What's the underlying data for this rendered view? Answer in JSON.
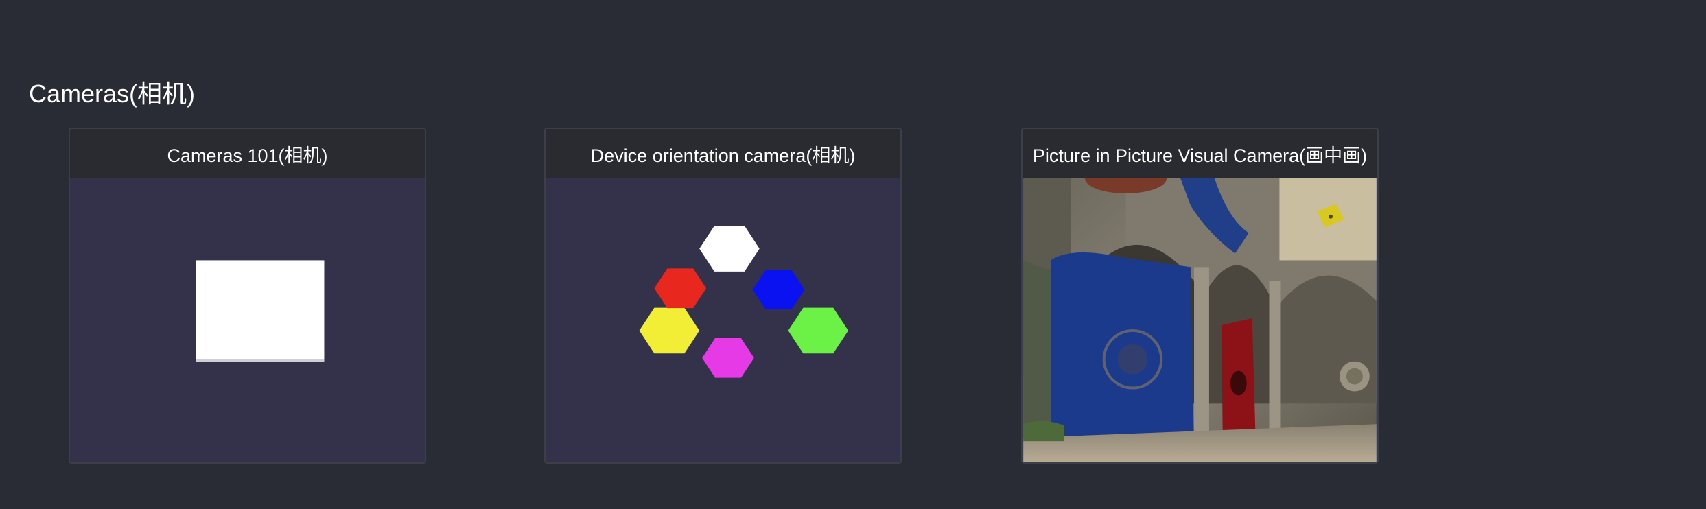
{
  "section": {
    "title": "Cameras(相机)"
  },
  "cards": [
    {
      "title": "Cameras 101(相机)",
      "thumbnail": "white-rectangle-scene"
    },
    {
      "title": "Device orientation camera(相机)",
      "thumbnail": "colored-hexagons-scene",
      "hexagon_colors": [
        "#ffffff",
        "#0a12f2",
        "#6cf247",
        "#e63ae6",
        "#f2ee35",
        "#e8281f"
      ]
    },
    {
      "title": "Picture in Picture Visual Camera(画中画)",
      "thumbnail": "sponza-courtyard-scene"
    }
  ],
  "colors": {
    "page_background": "#292c34",
    "card_header_background": "#292b31",
    "card_body_background": "#33324a"
  }
}
